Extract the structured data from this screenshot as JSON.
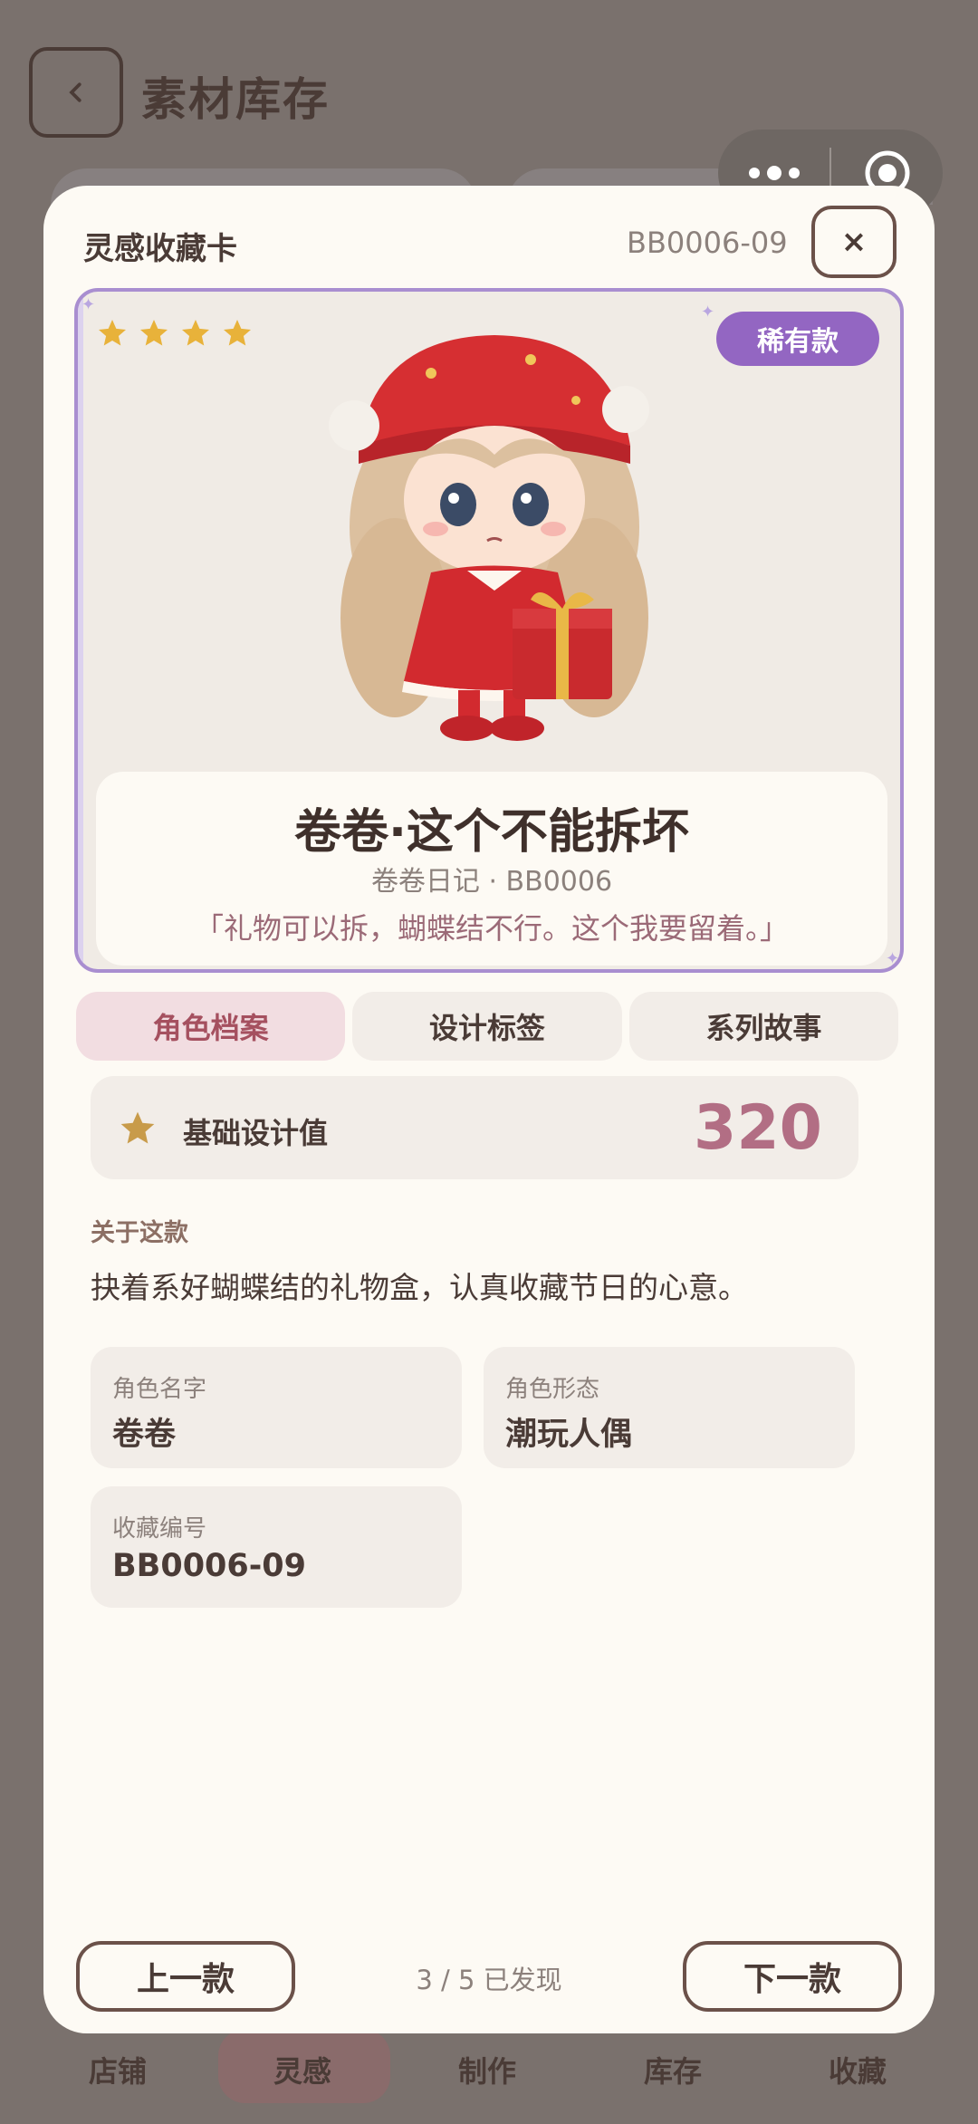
{
  "background": {
    "page_title": "素材库存",
    "nav": [
      "店铺",
      "灵感",
      "制作",
      "库存",
      "收藏"
    ],
    "active_nav": "灵感"
  },
  "modal": {
    "title": "灵感收藏卡",
    "code": "BB0006-09",
    "close_icon": "×"
  },
  "card": {
    "stars": 4,
    "rarity": "稀有款",
    "name": "卷卷·这个不能拆坏",
    "subtitle": "卷卷日记 · BB0006",
    "quote": "「礼物可以拆，蝴蝶结不行。这个我要留着。」"
  },
  "tabs": [
    "角色档案",
    "设计标签",
    "系列故事"
  ],
  "active_tab": 0,
  "score": {
    "label": "基础设计值",
    "value": "320"
  },
  "about": {
    "heading": "关于这款",
    "text": "抉着系好蝴蝶结的礼物盒，认真收藏节日的心意。"
  },
  "fields": [
    {
      "label": "角色名字",
      "value": "卷卷"
    },
    {
      "label": "角色形态",
      "value": "潮玩人偶"
    },
    {
      "label": "收藏编号",
      "value": "BB0006-09"
    }
  ],
  "footer": {
    "prev": "上一款",
    "next": "下一款",
    "status": "3 / 5 已发现"
  },
  "colors": {
    "accent_purple": "#9366c2",
    "accent_pink": "#b26e84",
    "star_gold": "#e8b23a"
  }
}
